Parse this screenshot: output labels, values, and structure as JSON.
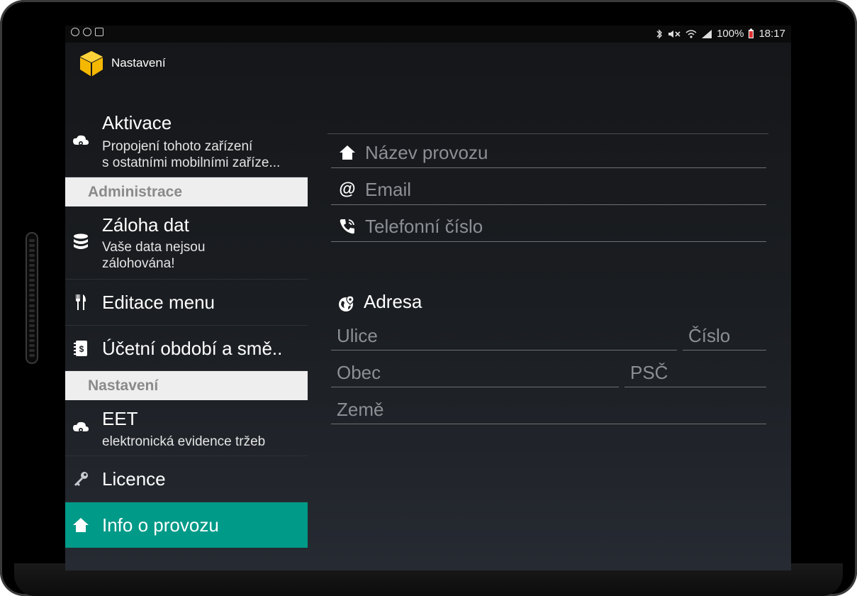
{
  "status": {
    "battery": "100%",
    "time": "18:17"
  },
  "app": {
    "title": "Nastavení"
  },
  "sidebar": {
    "aktivace": {
      "title": "Aktivace",
      "sub1": "Propojení tohoto zařízení",
      "sub2": "s ostatními mobilními zaříze..."
    },
    "header_admin": "Administrace",
    "zaloha": {
      "title": "Záloha dat",
      "sub1": "Vaše data nejsou",
      "sub2": "zálohována!"
    },
    "editace": {
      "title": "Editace menu"
    },
    "ucetni": {
      "title": "Účetní období a smě.."
    },
    "header_nastaveni": "Nastavení",
    "eet": {
      "title": "EET",
      "sub1": "elektronická evidence tržeb"
    },
    "licence": {
      "title": "Licence"
    },
    "info": {
      "title": "Info o provozu"
    }
  },
  "form": {
    "nazev_placeholder": "Název provozu",
    "email_placeholder": "Email",
    "telefon_placeholder": "Telefonní číslo",
    "adresa_title": "Adresa",
    "ulice_placeholder": "Ulice",
    "cislo_placeholder": "Číslo",
    "obec_placeholder": "Obec",
    "psc_placeholder": "PSČ",
    "zeme_placeholder": "Země"
  },
  "colors": {
    "accent": "#009a88",
    "header_bg": "#eeeeee",
    "logo": "#f5b800"
  }
}
